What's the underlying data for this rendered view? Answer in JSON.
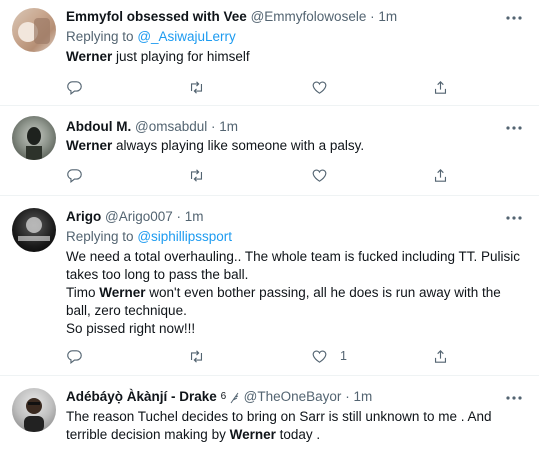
{
  "tweets": [
    {
      "name": "Emmyfol obsessed with Vee",
      "handle": "@Emmyfolowosele",
      "time": "1m",
      "replying_prefix": "Replying to",
      "replying_to": "@_AsiwajuLerry",
      "text_parts": [
        {
          "bold": true,
          "text": "Werner"
        },
        {
          "bold": false,
          "text": " just playing for himself"
        }
      ],
      "like_count": ""
    },
    {
      "name": "Abdoul M.",
      "handle": "@omsabdul",
      "time": "1m",
      "text_parts": [
        {
          "bold": true,
          "text": "Werner"
        },
        {
          "bold": false,
          "text": " always playing like someone with a palsy."
        }
      ],
      "like_count": ""
    },
    {
      "name": "Arigo",
      "handle": "@Arigo007",
      "time": "1m",
      "replying_prefix": "Replying to",
      "replying_to": "@siphillipssport",
      "lines": [
        [
          {
            "bold": false,
            "text": "We need a total overhauling.. The whole team is fucked including TT. Pulisic"
          }
        ],
        [
          {
            "bold": false,
            "text": "takes too long to pass the ball."
          }
        ],
        [
          {
            "bold": false,
            "text": "Timo "
          },
          {
            "bold": true,
            "text": "Werner"
          },
          {
            "bold": false,
            "text": " won't even bother passing, all he does is run away with the"
          }
        ],
        [
          {
            "bold": false,
            "text": "ball, zero technique."
          }
        ],
        [
          {
            "bold": false,
            "text": "So pissed right now!!!"
          }
        ]
      ],
      "like_count": "1"
    },
    {
      "name": "Adébáyọ̀ Àkànjí - Drake",
      "name_suffix": "6",
      "handle": "@TheOneBayor",
      "time": "1m",
      "lines": [
        [
          {
            "bold": false,
            "text": "The reason Tuchel decides to bring on Sarr is still unknown to me . And"
          }
        ],
        [
          {
            "bold": false,
            "text": "terrible decision making by "
          },
          {
            "bold": true,
            "text": "Werner"
          },
          {
            "bold": false,
            "text": " today ."
          }
        ]
      ],
      "like_count": ""
    }
  ],
  "separator": "·",
  "icons": {
    "reply": "reply-icon",
    "retweet": "retweet-icon",
    "like": "like-icon",
    "share": "share-icon",
    "more": "more-icon"
  },
  "colors": {
    "accent": "#1d9bf0",
    "secondary_text": "#536471",
    "primary_text": "#0f1419",
    "divider": "#eff3f4"
  }
}
